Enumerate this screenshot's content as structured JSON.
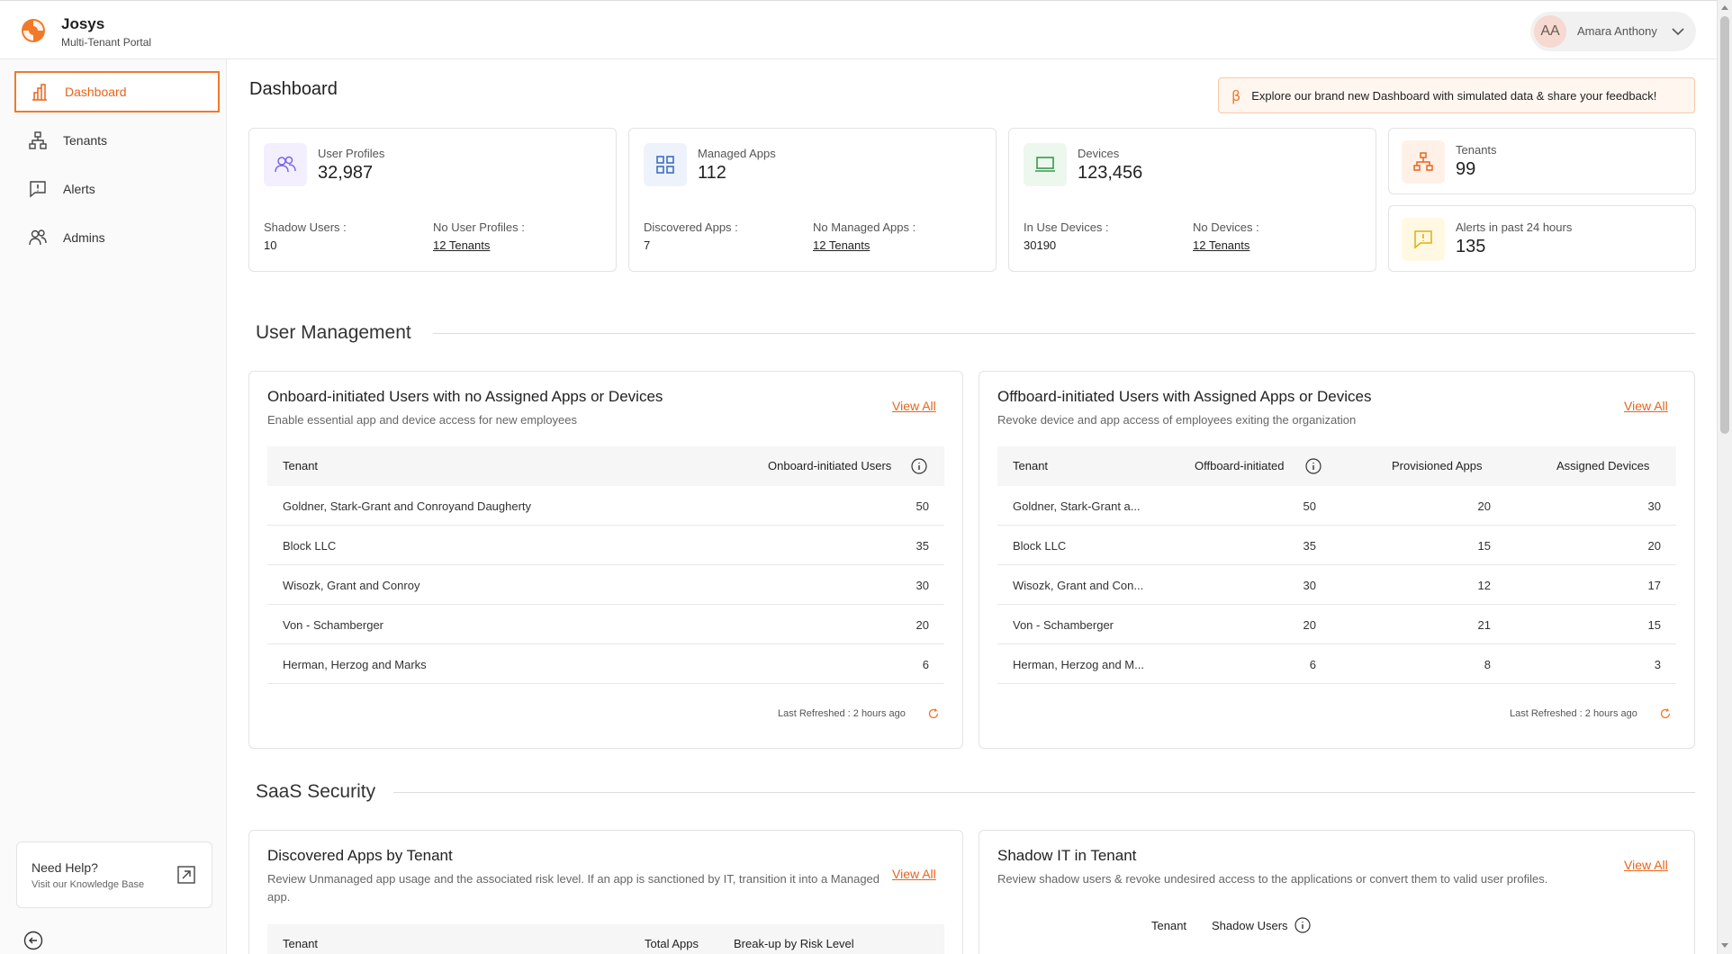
{
  "header": {
    "brand_name": "Josys",
    "brand_sub": "Multi-Tenant Portal",
    "user_initials": "AA",
    "user_name": "Amara Anthony"
  },
  "sidebar": {
    "items": [
      {
        "label": "Dashboard",
        "icon": "bar-chart-icon",
        "active": true
      },
      {
        "label": "Tenants",
        "icon": "org-chart-icon",
        "active": false
      },
      {
        "label": "Alerts",
        "icon": "alert-message-icon",
        "active": false
      },
      {
        "label": "Admins",
        "icon": "users-icon",
        "active": false
      }
    ],
    "help_title": "Need Help?",
    "help_sub": "Visit our Knowledge Base"
  },
  "page": {
    "title": "Dashboard",
    "banner_symbol": "β",
    "banner_text": "Explore our brand new Dashboard with simulated data & share your feedback!"
  },
  "stats": {
    "user_profiles": {
      "label": "User Profiles",
      "value": "32,987",
      "sub1_label": "Shadow Users :",
      "sub1_value": "10",
      "sub2_label": "No User Profiles :",
      "sub2_value": "12 Tenants"
    },
    "managed_apps": {
      "label": "Managed Apps",
      "value": "112",
      "sub1_label": "Discovered Apps :",
      "sub1_value": "7",
      "sub2_label": "No Managed Apps :",
      "sub2_value": "12 Tenants"
    },
    "devices": {
      "label": "Devices",
      "value": "123,456",
      "sub1_label": "In Use Devices :",
      "sub1_value": "30190",
      "sub2_label": "No Devices :",
      "sub2_value": "12 Tenants"
    },
    "tenants": {
      "label": "Tenants",
      "value": "99"
    },
    "alerts": {
      "label": "Alerts in past 24 hours",
      "value": "135"
    }
  },
  "user_management": {
    "section_title": "User Management",
    "onboard": {
      "title": "Onboard-initiated Users with no Assigned Apps or Devices",
      "desc": "Enable essential app and device access for new employees",
      "view_all": "View All",
      "col_tenant": "Tenant",
      "col_users": "Onboard-initiated Users",
      "rows": [
        {
          "tenant": "Goldner, Stark-Grant and Conroyand Daugherty",
          "users": "50"
        },
        {
          "tenant": "Block LLC",
          "users": "35"
        },
        {
          "tenant": "Wisozk, Grant and Conroy",
          "users": "30"
        },
        {
          "tenant": "Von - Schamberger",
          "users": "20"
        },
        {
          "tenant": "Herman, Herzog and Marks",
          "users": "6"
        }
      ],
      "refreshed": "Last Refreshed : 2 hours ago"
    },
    "offboard": {
      "title": "Offboard-initiated Users with Assigned Apps or Devices",
      "desc": "Revoke device and app access of employees exiting the organization",
      "view_all": "View All",
      "col_tenant": "Tenant",
      "col_users": "Offboard-initiated",
      "col_apps": "Provisioned Apps",
      "col_devices": "Assigned Devices",
      "rows": [
        {
          "tenant": "Goldner, Stark-Grant a...",
          "users": "50",
          "apps": "20",
          "devices": "30"
        },
        {
          "tenant": "Block LLC",
          "users": "35",
          "apps": "15",
          "devices": "20"
        },
        {
          "tenant": "Wisozk, Grant and Con...",
          "users": "30",
          "apps": "12",
          "devices": "17"
        },
        {
          "tenant": "Von - Schamberger",
          "users": "20",
          "apps": "21",
          "devices": "15"
        },
        {
          "tenant": "Herman, Herzog and M...",
          "users": "6",
          "apps": "8",
          "devices": "3"
        }
      ],
      "refreshed": "Last Refreshed : 2 hours ago"
    }
  },
  "saas_security": {
    "section_title": "SaaS Security",
    "discovered": {
      "title": "Discovered Apps by Tenant",
      "desc": "Review Unmanaged app usage and the associated risk level. If an app is sanctioned by IT, transition it into a Managed app.",
      "view_all": "View All",
      "col_tenant": "Tenant",
      "col_total": "Total Apps",
      "col_risk": "Break-up by Risk Level"
    },
    "shadow_it": {
      "title": "Shadow IT in Tenant",
      "desc": "Review shadow users & revoke undesired access to the applications or convert them to valid user profiles.",
      "view_all": "View All",
      "col_tenant": "Tenant",
      "col_shadow": "Shadow Users"
    }
  },
  "colors": {
    "accent": "#f07a2a",
    "accent_text": "#e8641b"
  }
}
